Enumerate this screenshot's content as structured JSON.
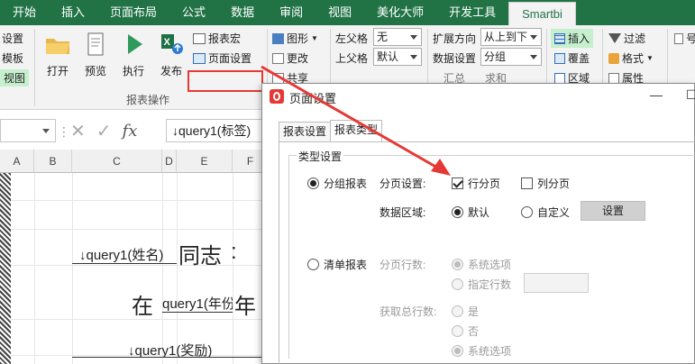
{
  "tabs": [
    "开始",
    "插入",
    "页面布局",
    "公式",
    "数据",
    "审阅",
    "视图",
    "美化大师",
    "开发工具",
    "Smartbi"
  ],
  "ribbon": {
    "left_items": [
      "设置",
      "模板",
      "视图"
    ],
    "open": "打开",
    "preview": "预览",
    "run": "执行",
    "publish": "发布",
    "report_macro": "报表宏",
    "page_setup": "页面设置",
    "group_report_ops": "报表操作",
    "shape": "图形",
    "change": "更改",
    "share": "共享",
    "left_parent_label": "左父格",
    "left_parent_value": "无",
    "top_parent_label": "上父格",
    "top_parent_value": "默认",
    "expand_dir_label": "扩展方向",
    "expand_dir_value": "从上到下",
    "data_setting_label": "数据设置",
    "data_setting_value": "分组",
    "summary": "汇总",
    "sum": "求和",
    "insert": "插入",
    "cover": "覆盖",
    "area": "区域",
    "filter": "过滤",
    "format": "格式",
    "attribute": "属性",
    "partial_right": "号"
  },
  "formula_bar": {
    "content": "↓query1(标签)"
  },
  "grid": {
    "columns": [
      "A",
      "B",
      "C",
      "D",
      "E",
      "F"
    ],
    "cell_name": "↓query1(姓名)",
    "comrade": "同志",
    "colon": ":",
    "at": "在",
    "cell_year": "query1(年份",
    "year": "年",
    "cell_award": "↓query1(奖励)"
  },
  "dialog": {
    "title": "页面设置",
    "tabs": [
      "报表设置",
      "报表类型"
    ],
    "section": "类型设置",
    "group_report": "分组报表",
    "paging_label": "分页设置:",
    "row_paging": "行分页",
    "col_paging": "列分页",
    "data_area_label": "数据区域:",
    "default": "默认",
    "custom": "自定义",
    "set_button": "设置",
    "list_report": "清单报表",
    "page_rows_label": "分页行数:",
    "system_option": "系统选项",
    "specify_rows": "指定行数",
    "get_total_label": "获取总行数:",
    "yes": "是",
    "no": "否",
    "system_option2": "系统选项"
  }
}
